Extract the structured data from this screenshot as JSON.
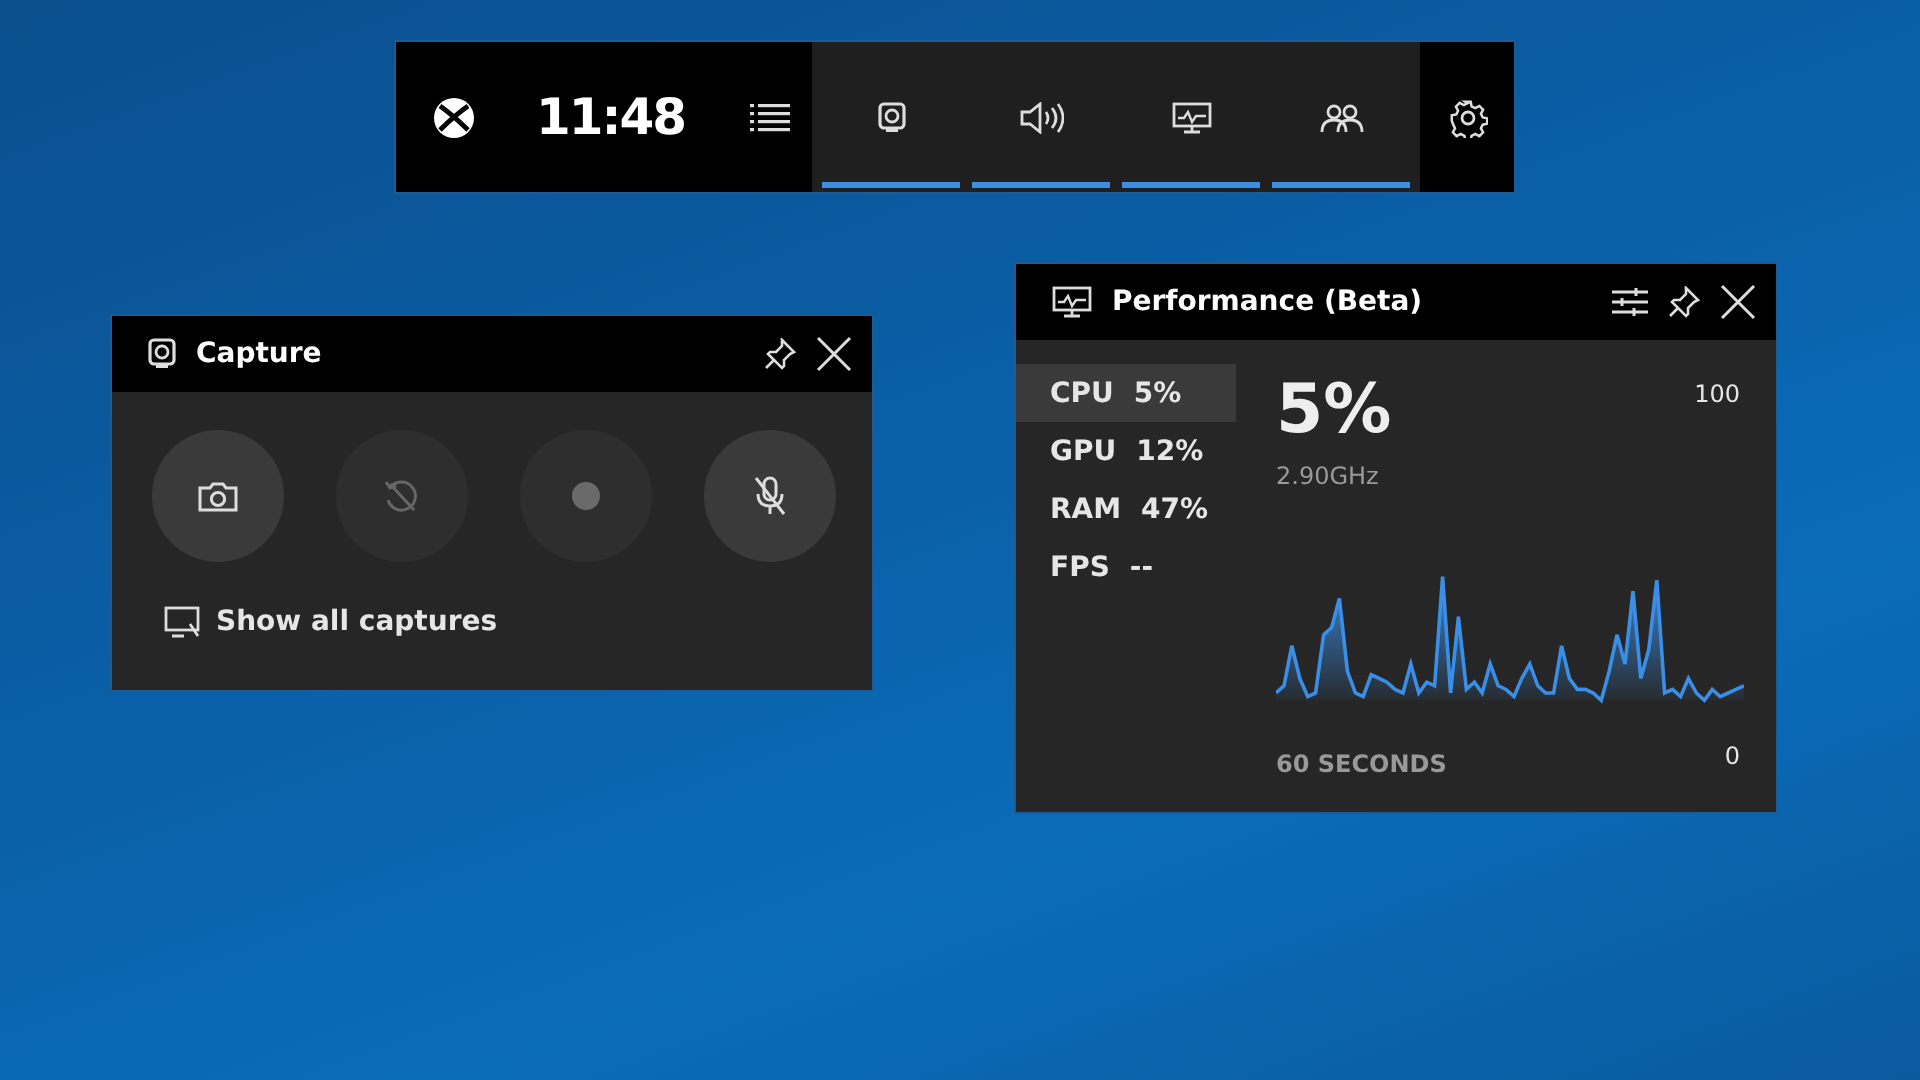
{
  "game_bar": {
    "time": "11:48",
    "widgets": [
      {
        "kind": "capture",
        "on": true
      },
      {
        "kind": "audio",
        "on": true
      },
      {
        "kind": "performance",
        "on": true
      },
      {
        "kind": "social",
        "on": true
      }
    ]
  },
  "capture": {
    "title": "Capture",
    "buttons": [
      {
        "kind": "screenshot",
        "disabled": false
      },
      {
        "kind": "record-last",
        "disabled": true
      },
      {
        "kind": "record",
        "disabled": true
      },
      {
        "kind": "mic",
        "disabled": false
      }
    ],
    "link": "Show all captures"
  },
  "performance": {
    "title": "Performance (Beta)",
    "metrics": [
      {
        "name": "CPU",
        "value": "5%",
        "selected": true
      },
      {
        "name": "GPU",
        "value": "12%",
        "selected": false
      },
      {
        "name": "RAM",
        "value": "47%",
        "selected": false
      },
      {
        "name": "FPS",
        "value": "--",
        "selected": false
      }
    ],
    "big_value": "5%",
    "frequency": "2.90GHz",
    "max_label": "100",
    "min_label": "0",
    "time_label": "60 SECONDS"
  }
}
